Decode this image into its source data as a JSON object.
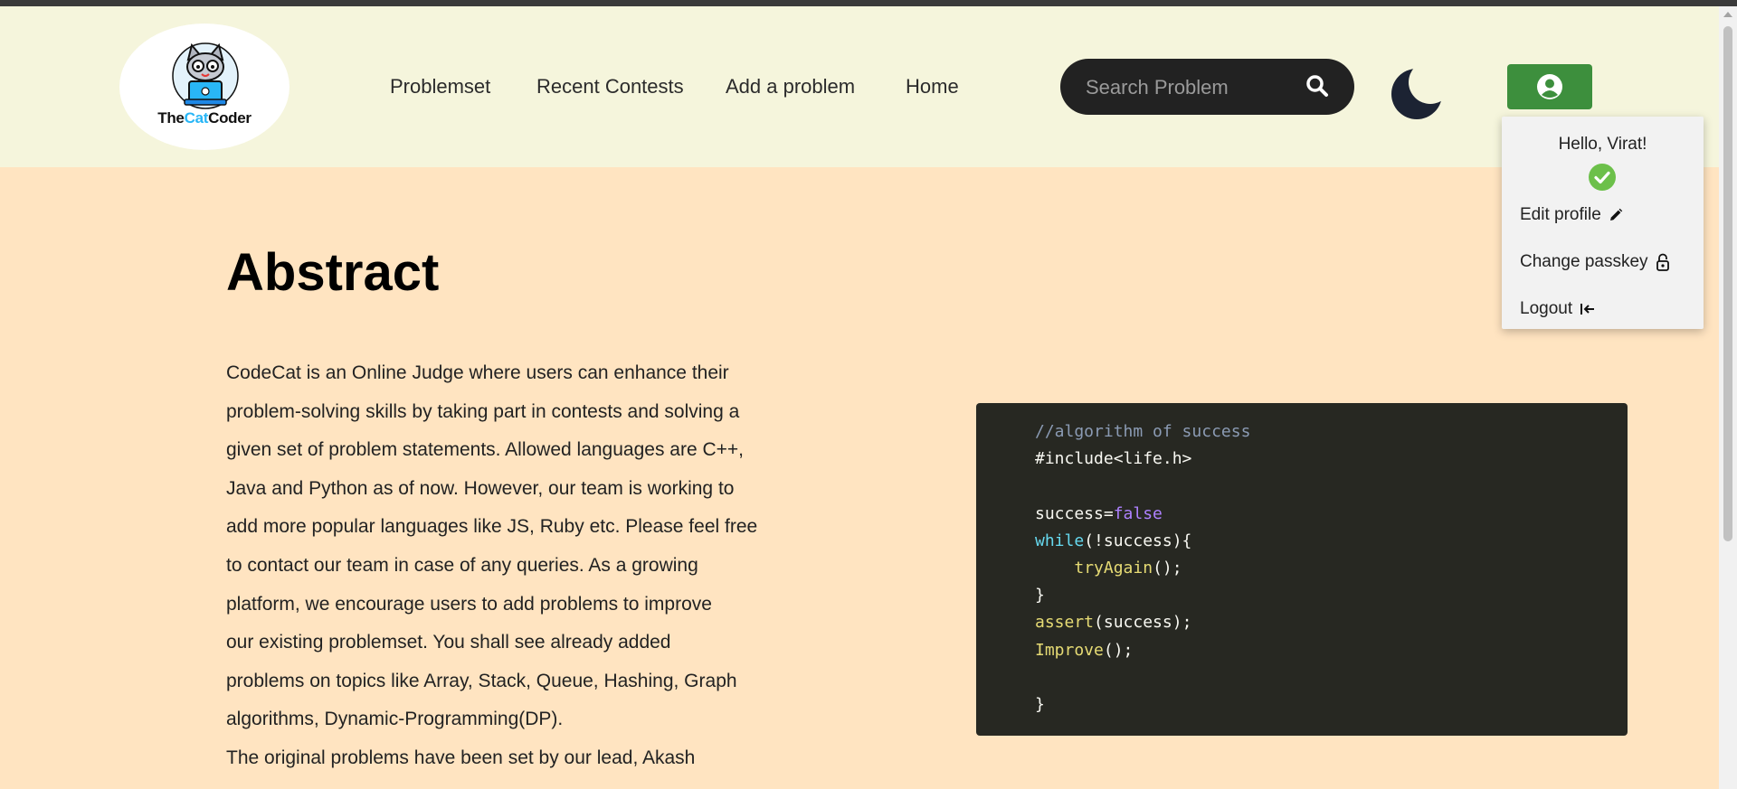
{
  "brand": {
    "logo_prefix": "The",
    "logo_cat": "Cat",
    "logo_suffix": "Coder"
  },
  "nav": {
    "items": [
      "Problemset",
      "Recent Contests",
      "Add a problem",
      "Home"
    ]
  },
  "search": {
    "placeholder": "Search Problem",
    "icon": "search-icon"
  },
  "theme_toggle": {
    "icon": "moon-icon"
  },
  "profile": {
    "icon": "user-circle-icon",
    "accent": "#3d8f3d",
    "dropdown": {
      "greeting": "Hello, Virat!",
      "status_icon": "check-circle-icon",
      "items": [
        {
          "label": "Edit profile",
          "icon": "pencil-icon"
        },
        {
          "label": "Change passkey",
          "icon": "lock-icon"
        },
        {
          "label": "Logout",
          "icon": "logout-icon"
        }
      ]
    }
  },
  "main": {
    "title": "Abstract",
    "paragraph_lines": [
      "CodeCat is an Online Judge where users can enhance their",
      "problem-solving skills by taking part in contests and solving a",
      "given set of problem statements. Allowed languages are C++,",
      "Java and Python as of now. However, our team is working to",
      "add more popular languages like JS, Ruby etc. Please feel free",
      "to contact our team in case of any queries. As a growing",
      "platform, we encourage users to add problems to improve",
      "our existing problemset. You shall see already added",
      "problems on topics like Array, Stack, Queue, Hashing, Graph",
      "algorithms, Dynamic-Programming(DP)."
    ],
    "paragraph2": "The original problems have been set by our lead, Akash"
  },
  "code_block": {
    "comment": "//algorithm of success",
    "include": "#include<life.h>",
    "assign_var": "success=",
    "assign_val": "false",
    "while_kw": "while",
    "while_cond": "(!success){",
    "try_fn": "tryAgain",
    "try_rest": "();",
    "close1": "}",
    "assert_fn": "assert",
    "assert_rest": "(success);",
    "improve_fn": "Improve",
    "improve_rest": "();",
    "close2": "}"
  },
  "colors": {
    "header_bg": "#f5f5dc",
    "page_bg": "#ffe4c1",
    "code_bg": "#272822",
    "search_bg": "#222222"
  }
}
